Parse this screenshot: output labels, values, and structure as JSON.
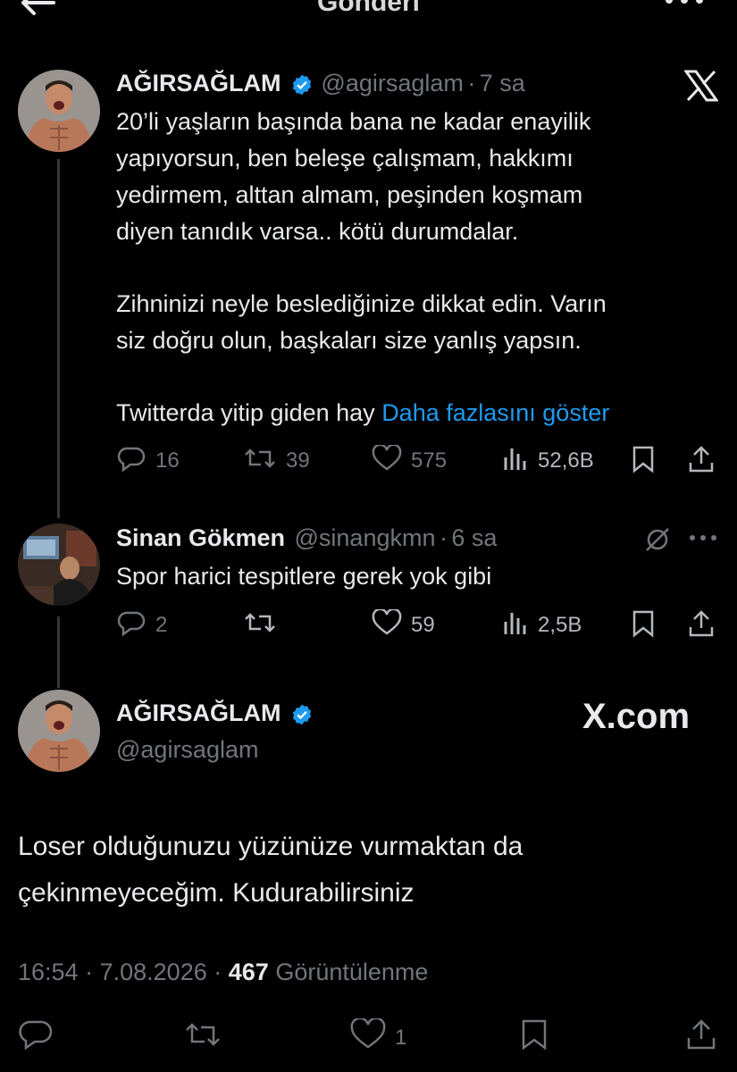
{
  "header": {
    "title": "Gönderi",
    "back_icon": "arrow-left-icon",
    "more_icon": "more-horizontal-icon"
  },
  "tweet1": {
    "name": "AĞIRSAĞLAM",
    "handle": "@agirsaglam",
    "dot": "·",
    "time": "7 sa",
    "lines": [
      "20’li yaşların başında bana ne kadar enayilik",
      "yapıyorsun, ben beleşe çalışmam, hakkımı",
      "yedirmem, alttan almam, peşinden koşmam",
      "diyen tanıdık varsa.. kötü durumdalar.",
      "Zihninizi neyle beslediğinize dikkat edin. Varın",
      "siz doğru olun, başkaları size yanlış yapsın.",
      "Twitterda yitip giden hay"
    ],
    "show_more": "Daha fazlasını göster",
    "replies": "16",
    "retweets": "39",
    "likes": "575",
    "views": "52,6B"
  },
  "tweet2": {
    "name": "Sinan Gökmen",
    "handle": "@sinangkmn",
    "dot": "·",
    "time": "6 sa",
    "text": "Spor harici tespitlere gerek yok gibi",
    "replies": "2",
    "retweets": "",
    "likes": "59",
    "views": "2,5B"
  },
  "main": {
    "name": "AĞIRSAĞLAM",
    "handle": "@agirsaglam",
    "watermark": "X.com",
    "lines": [
      "Loser olduğunuzu yüzünüze vurmaktan da",
      "çekinmeyeceğim. Kudurabilirsiniz"
    ],
    "time": "16:54",
    "dot1": "·",
    "date": "7.08.2026",
    "dot2": "·",
    "views_count": "467",
    "views_label": "Görüntülenme",
    "likes": "1"
  },
  "colors": {
    "background": "#000000",
    "text": "#e7e9ea",
    "muted": "#71767b",
    "link": "#1d9bf0",
    "verified": "#1d9bf0"
  }
}
